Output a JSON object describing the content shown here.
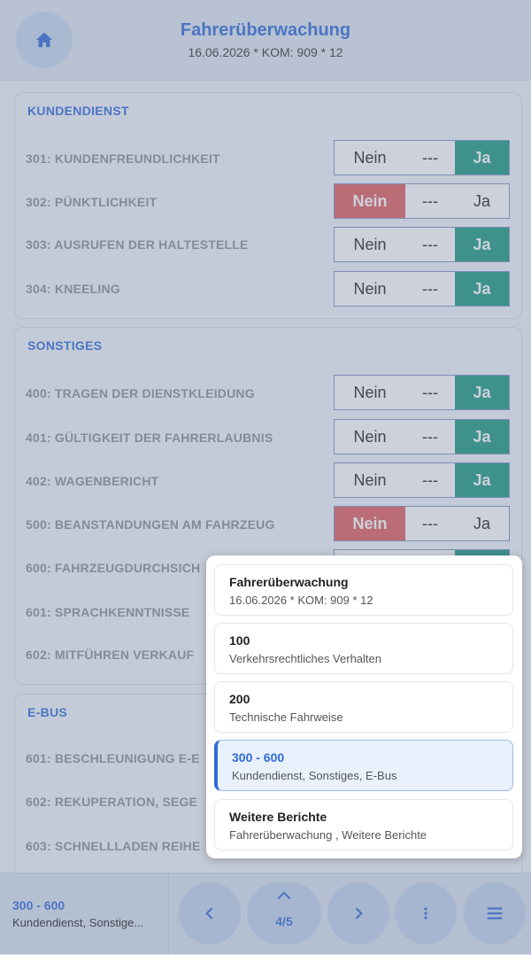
{
  "header": {
    "title": "Fahrerüberwachung",
    "subtitle": "16.06.2026 * KOM: 909 * 12",
    "home_icon": "home-icon"
  },
  "sections": [
    {
      "title": "KUNDENDIENST",
      "rows": [
        {
          "label": "301: KUNDENFREUNDLICHKEIT",
          "selected": "ja"
        },
        {
          "label": "302: PÜNKTLICHKEIT",
          "selected": "nein"
        },
        {
          "label": "303: AUSRUFEN DER HALTESTELLE",
          "selected": "ja"
        },
        {
          "label": "304: KNEELING",
          "selected": "ja"
        }
      ]
    },
    {
      "title": "SONSTIGES",
      "rows": [
        {
          "label": "400: TRAGEN DER DIENSTKLEIDUNG",
          "selected": "ja"
        },
        {
          "label": "401: GÜLTIGKEIT DER FAHRERLAUBNIS",
          "selected": "ja"
        },
        {
          "label": "402: WAGENBERICHT",
          "selected": "ja"
        },
        {
          "label": "500: BEANSTANDUNGEN AM FAHRZEUG",
          "selected": "nein"
        },
        {
          "label": "600: FAHRZEUGDURCHSICH",
          "selected": "ja"
        },
        {
          "label": "601: SPRACHKENNTNISSE",
          "selected": ""
        },
        {
          "label": "602: MITFÜHREN VERKAUF",
          "selected": ""
        }
      ]
    },
    {
      "title": "E-BUS",
      "rows": [
        {
          "label": "601: BESCHLEUNIGUNG E-E",
          "selected": ""
        },
        {
          "label": "602: REKUPERATION, SEGE",
          "selected": ""
        },
        {
          "label": "603: SCHNELLLADEN REIHE",
          "selected": ""
        }
      ]
    }
  ],
  "segment": {
    "nein": "Nein",
    "neutral": "---",
    "ja": "Ja"
  },
  "popup": {
    "items": [
      {
        "title": "Fahrerüberwachung",
        "subtitle": "16.06.2026 * KOM: 909 * 12",
        "selected": false
      },
      {
        "title": "100",
        "subtitle": "Verkehrsrechtliches Verhalten",
        "selected": false
      },
      {
        "title": "200",
        "subtitle": "Technische Fahrweise",
        "selected": false
      },
      {
        "title": "300 - 600",
        "subtitle": "Kundendienst, Sonstiges, E-Bus",
        "selected": true
      },
      {
        "title": "Weitere Berichte",
        "subtitle": "Fahrerüberwachung , Weitere Berichte",
        "selected": false
      }
    ]
  },
  "footer": {
    "current_title": "300 - 600",
    "current_subtitle": "Kundendienst, Sonstige...",
    "page_indicator": "4/5",
    "prev_icon": "chevron-left-icon",
    "next_icon": "chevron-right-icon",
    "up_icon": "chevron-up-icon",
    "more_icon": "more-vertical-icon",
    "menu_icon": "menu-icon"
  },
  "colors": {
    "accent": "#2f6bd8",
    "ja": "#1b9a7f",
    "nein": "#e25e5e"
  }
}
